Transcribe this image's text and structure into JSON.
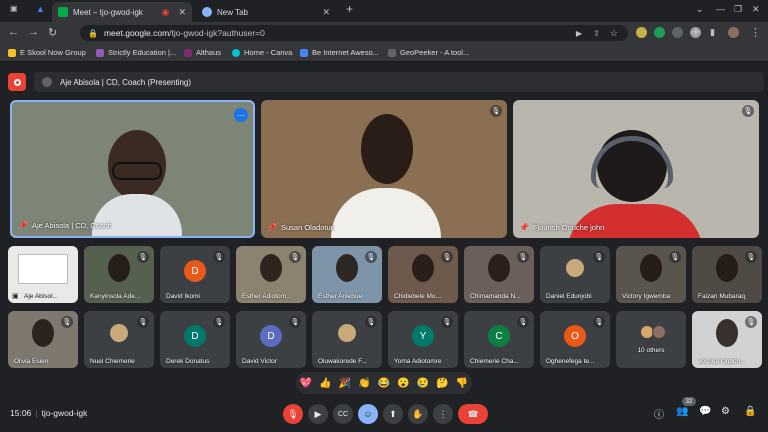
{
  "browser": {
    "tabs": [
      {
        "label": "Meet – tjo-gwod-igk",
        "active": true
      },
      {
        "label": "New Tab",
        "active": false
      }
    ],
    "new_tab": "+",
    "address": {
      "host": "meet.google.com",
      "path": "/tjo-gwod-igk?authuser=0"
    },
    "bookmarks": [
      "E Skool Now Group",
      "Strictly Education |...",
      "Althaus",
      "Home - Canva",
      "Be Internet Aweso...",
      "GeoPeeker - A tool..."
    ]
  },
  "presenting": {
    "label": "Aje Abisola | CD, Coach (Presenting)"
  },
  "main_tiles": [
    {
      "name": "Aje Abisola | CD, Coach",
      "bg": "#7d8577"
    },
    {
      "name": "Susan Oladotun",
      "bg": "#8a6f52"
    },
    {
      "name": "Flourish Oguche john",
      "bg": "#b9b6ad"
    }
  ],
  "row1": [
    {
      "name": "Aje Abisol...",
      "type": "screen",
      "bg": "#e9e9e9"
    },
    {
      "name": "Kanyinsola Ade...",
      "type": "video",
      "bg": "#55604f"
    },
    {
      "name": "David Ikomi",
      "type": "avatar",
      "initial": "D",
      "color": "#e8591a"
    },
    {
      "name": "Esther Adiotom...",
      "type": "video",
      "bg": "#8d8270"
    },
    {
      "name": "Esther Aniebue",
      "type": "video",
      "bg": "#7d94a9"
    },
    {
      "name": "Chidiebele Mo...",
      "type": "video",
      "bg": "#6e5a4c"
    },
    {
      "name": "Chimamanda N...",
      "type": "video",
      "bg": "#6b5f59"
    },
    {
      "name": "Daniel Edunjobi",
      "type": "photo",
      "bg": "#3c4043"
    },
    {
      "name": "Victory Igwemba",
      "type": "video",
      "bg": "#59544c"
    },
    {
      "name": "Faizan Mubaraq",
      "type": "video",
      "bg": "#4f4a44"
    }
  ],
  "row2": [
    {
      "name": "Olivia Esien",
      "type": "video",
      "bg": "#7e786e"
    },
    {
      "name": "Nuel Chiemerie",
      "type": "photo",
      "bg": "#3c4043"
    },
    {
      "name": "Derek Donatus",
      "type": "avatar",
      "initial": "D",
      "color": "#00796b"
    },
    {
      "name": "David Victor",
      "type": "avatar",
      "initial": "D",
      "color": "#5c6bc0"
    },
    {
      "name": "Oluwakorede F...",
      "type": "photo",
      "bg": "#3c4043"
    },
    {
      "name": "Yoma Adiotomre",
      "type": "avatar",
      "initial": "Y",
      "color": "#00796b"
    },
    {
      "name": "Chiemerie Cha...",
      "type": "avatar",
      "initial": "C",
      "color": "#0b8043"
    },
    {
      "name": "Oghenefega te...",
      "type": "avatar",
      "initial": "O",
      "color": "#e8591a"
    },
    {
      "name": "10 others",
      "type": "others",
      "bg": "#3c4043"
    },
    {
      "name": "Joshua Ogbon...",
      "type": "video",
      "bg": "#d0d2d4"
    }
  ],
  "reactions": [
    "💖",
    "👍",
    "🎉",
    "👏",
    "😂",
    "😮",
    "😢",
    "🤔",
    "👎"
  ],
  "meeting": {
    "time": "15:06",
    "code": "tjo-gwod-igk",
    "participants_count": "32"
  }
}
